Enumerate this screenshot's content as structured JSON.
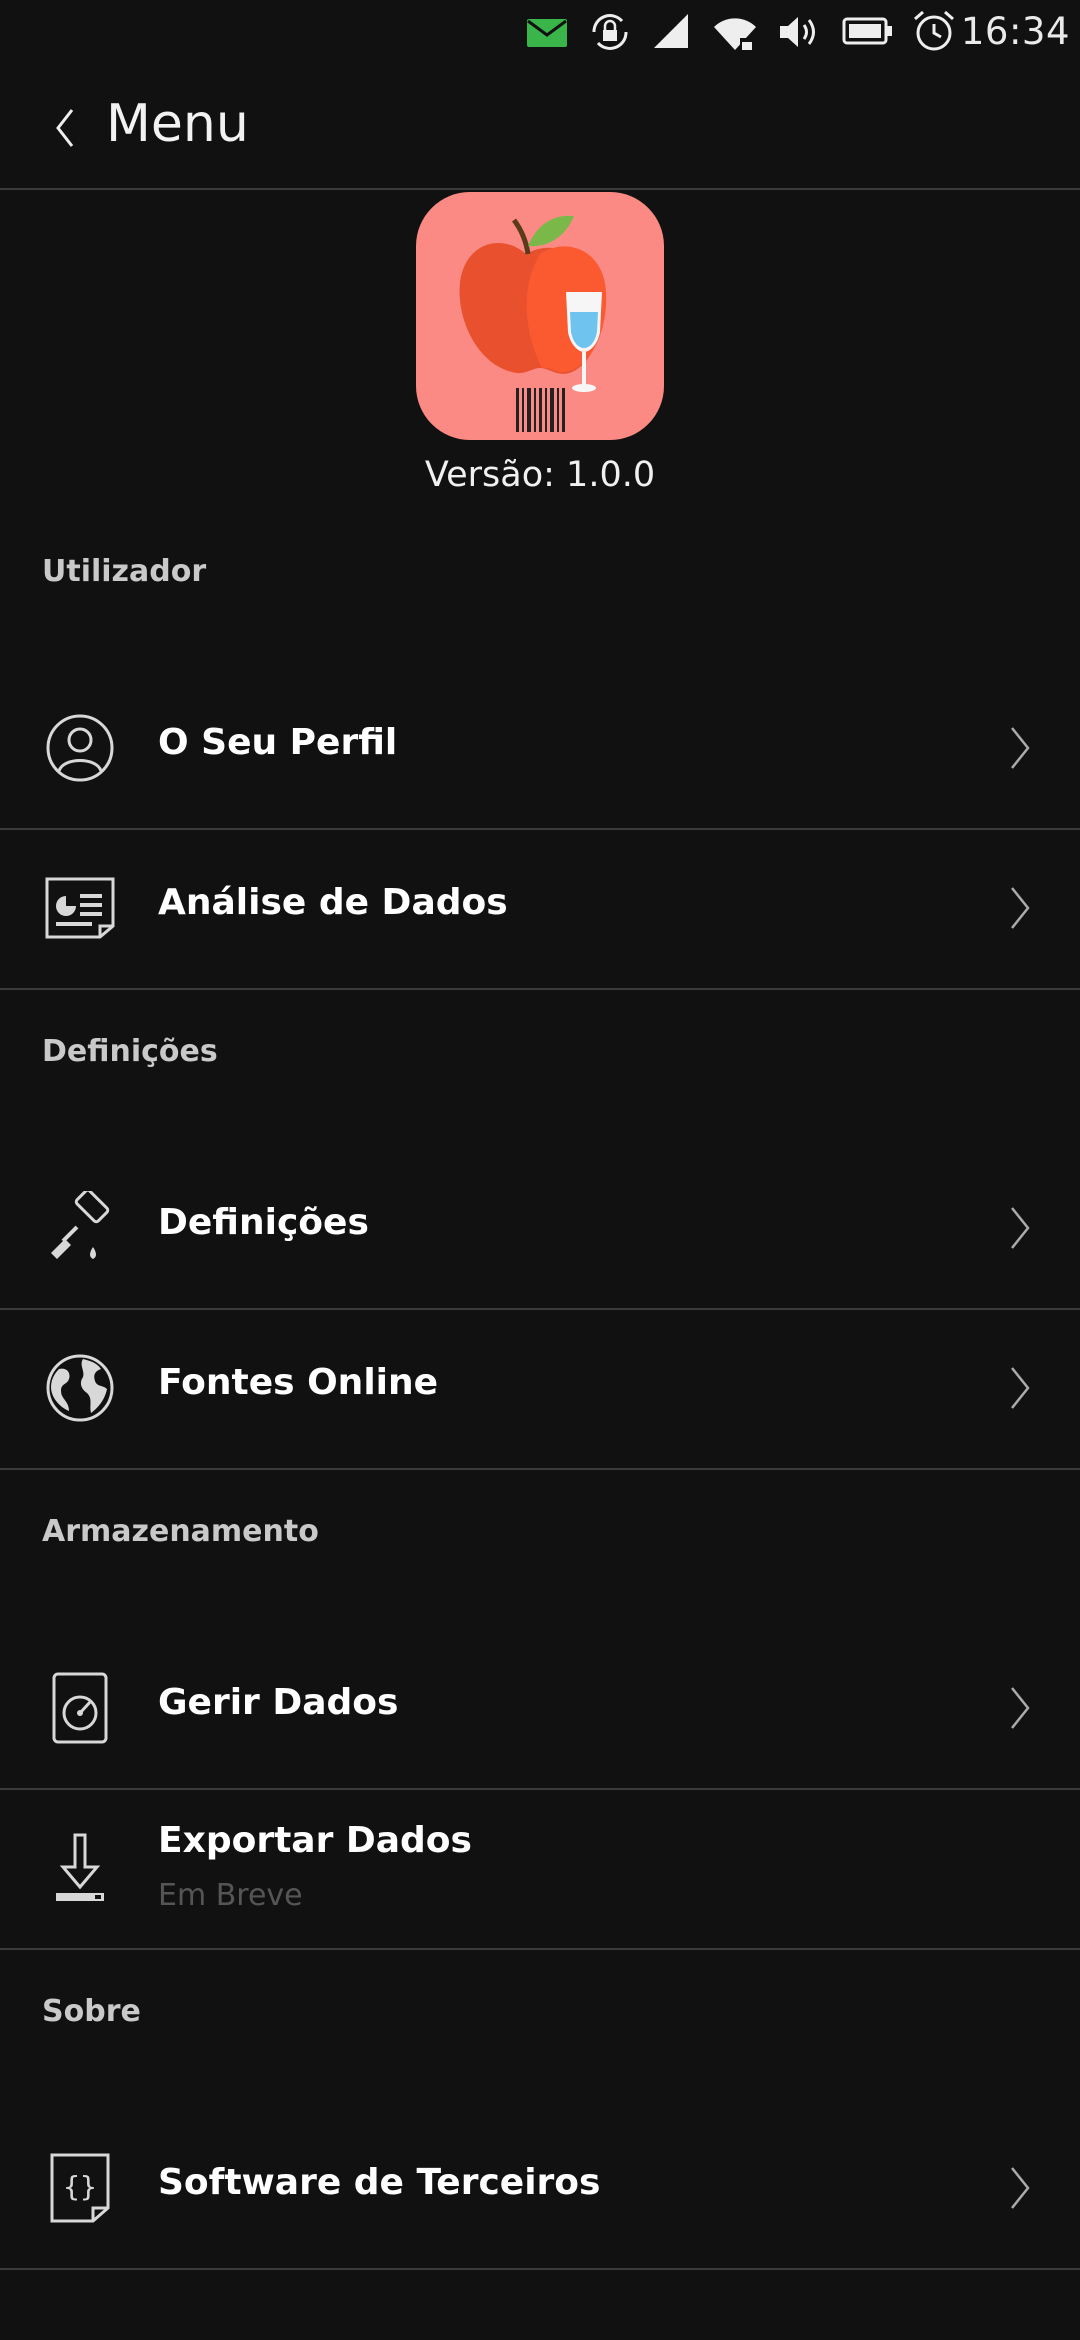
{
  "status_bar": {
    "time": "16:34",
    "icons": [
      "message-icon",
      "rotation-lock-icon",
      "cellular-signal-icon",
      "wifi-icon",
      "volume-icon",
      "battery-icon",
      "alarm-icon"
    ]
  },
  "header": {
    "title": "Menu"
  },
  "app": {
    "version_text": "Versão: 1.0.0"
  },
  "sections": {
    "user": "Utilizador",
    "settings": "Definições",
    "storage": "Armazenamento",
    "about": "Sobre"
  },
  "items": {
    "profile": {
      "label": "O Seu Perfil",
      "icon": "user-profile-icon"
    },
    "analysis": {
      "label": "Análise de Dados",
      "icon": "data-analysis-icon"
    },
    "settings": {
      "label": "Definições",
      "icon": "paint-roller-icon"
    },
    "online_sources": {
      "label": "Fontes Online",
      "icon": "globe-icon"
    },
    "manage_data": {
      "label": "Gerir Dados",
      "icon": "hard-drive-icon"
    },
    "export_data": {
      "label": "Exportar Dados",
      "sublabel": "Em Breve",
      "icon": "download-icon"
    },
    "third_party": {
      "label": "Software de Terceiros",
      "icon": "code-braces-icon"
    }
  },
  "colors": {
    "background": "#111111",
    "divider": "#3a3a3a",
    "app_icon_background": "#fb8a84",
    "apple": "#f05a32",
    "message_green": "#3ab54a"
  }
}
